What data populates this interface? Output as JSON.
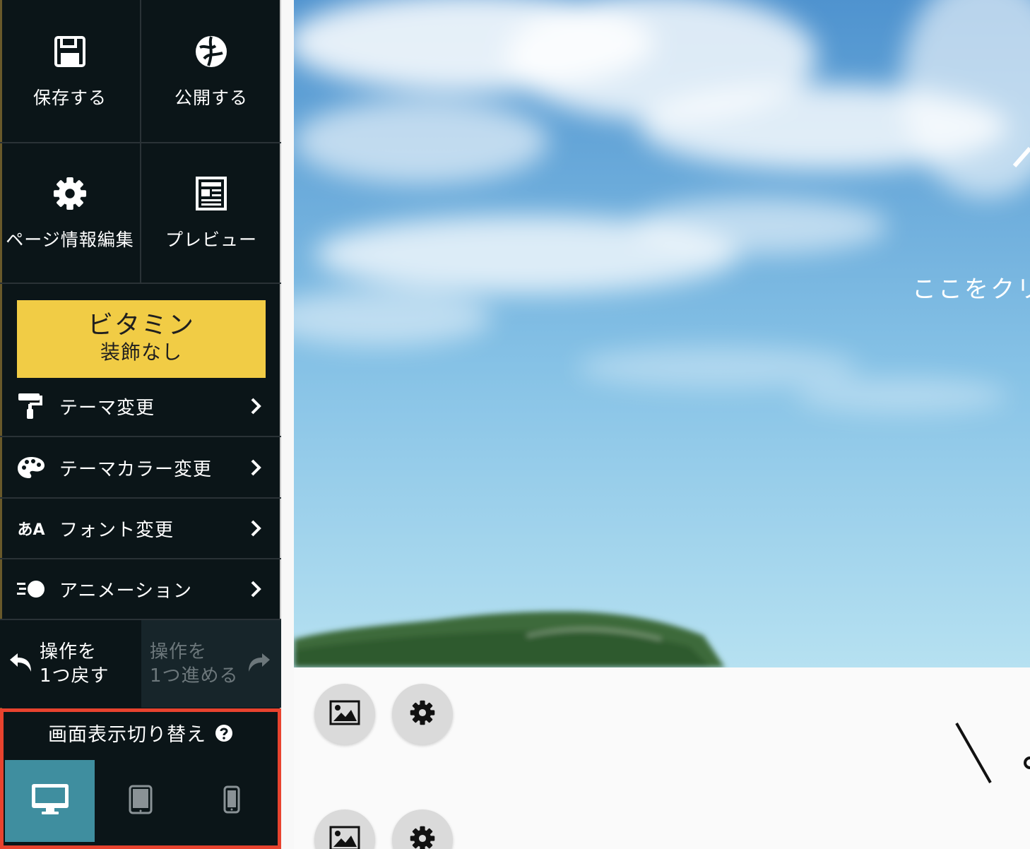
{
  "toolbar": {
    "save_label": "保存する",
    "publish_label": "公開する",
    "page_info_label": "ページ情報編集",
    "preview_label": "プレビュー"
  },
  "theme": {
    "name": "ビタミン",
    "decoration": "装飾なし",
    "card_color": "#f1cc45"
  },
  "menu": {
    "items": [
      {
        "label": "テーマ変更",
        "icon": "paint-roller-icon"
      },
      {
        "label": "テーマカラー変更",
        "icon": "palette-icon"
      },
      {
        "label": "フォント変更",
        "icon": "font-icon",
        "icon_glyph": "あA"
      },
      {
        "label": "アニメーション",
        "icon": "animation-icon"
      }
    ]
  },
  "history": {
    "undo_line1": "操作を",
    "undo_line2": "1つ戻す",
    "redo_line1": "操作を",
    "redo_line2": "1つ進める",
    "redo_enabled": false
  },
  "display_switch": {
    "title": "画面表示切り替え",
    "active_device": "desktop",
    "active_color": "#3f8e9f",
    "devices": [
      "desktop",
      "tablet",
      "smartphone"
    ]
  },
  "canvas": {
    "hero_caption": "ここをクリ"
  },
  "colors": {
    "sidebar_bg": "#0b1518",
    "highlight_border": "#e8432e"
  }
}
